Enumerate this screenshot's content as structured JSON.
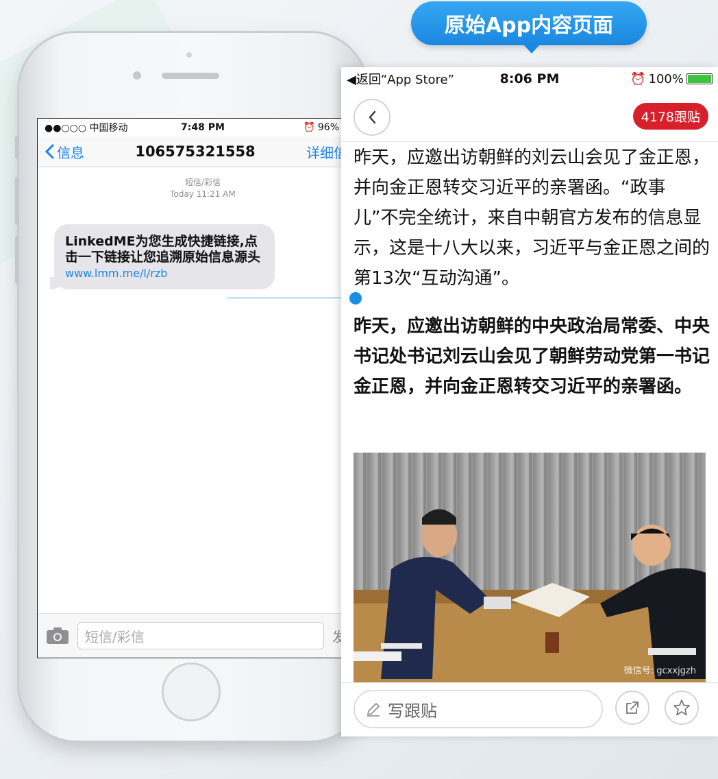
{
  "callout": {
    "label": "原始App内容页面"
  },
  "sms": {
    "status": {
      "carrier": "●●○○○ 中国移动",
      "time": "7:48 PM",
      "battery": "96%"
    },
    "nav": {
      "back_label": "信息",
      "title": "10657532155​8",
      "detail_label": "详细信息"
    },
    "meta": {
      "type": "短信/彩信",
      "timestamp": "Today 11:21 AM"
    },
    "message": {
      "text": "LinkedME为您生成快捷链接,点击一下链接让您追溯原始信息源头",
      "link": "www.lmm.me/l/rzb"
    },
    "composer": {
      "placeholder": "短信/彩信",
      "send_label": "发送"
    }
  },
  "app": {
    "status": {
      "back_to": "◀返回“App Store”",
      "time": "8:06 PM",
      "battery": "100%"
    },
    "badge": "4178跟贴",
    "paragraph1": "昨天，应邀出访朝鲜的刘云山会见了金正恩，并向金正恩转交习近平的亲署函。“政事儿”不完全统计，来自中朝官方发布的信息显示，这是十八大以来，习近平与金正恩之间的第13次“互动沟通”。",
    "paragraph2": "昨天，应邀出访朝鲜的中央政治局常委、中央书记处书记刘云山会见了朝鲜劳动党第一书记金正恩，并向金正恩转交习近平的亲署函。",
    "photo_watermark": "微信号: gcxxjgzh",
    "write_placeholder": "写跟贴"
  }
}
